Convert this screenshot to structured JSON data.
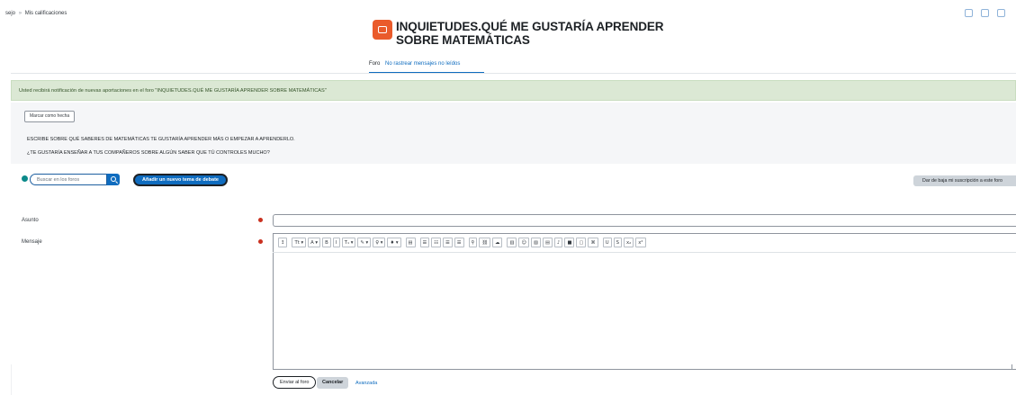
{
  "breadcrumb": {
    "left": "sejo",
    "sep": "»",
    "current": "Mis calificaciones"
  },
  "forum": {
    "title": "INQUIETUDES.QUÉ ME GUSTARÍA APRENDER SOBRE MATEMÁTICAS",
    "tabs": [
      "Foro",
      "No rastrear mensajes no leídos"
    ],
    "icon": "forum-icon"
  },
  "alert": {
    "text": "Usted recibirá notificación de nuevas aportaciones en el foro \"INQUIETUDES.QUÉ ME GUSTARÍA APRENDER SOBRE MATEMÁTICAS\""
  },
  "completion": {
    "mark_done_label": "Marcar como hecha"
  },
  "instructions": [
    "ESCRIBE SOBRE QUÉ SABERES DE MATEMÁTICAS TE GUSTARÍA APRENDER MÁS O EMPEZAR A APRENDERLO.",
    "¿TE GUSTARÍA ENSEÑAR A TUS COMPAÑEROS SOBRE ALGÚN SABER QUE TÚ CONTROLES MUCHO?"
  ],
  "search": {
    "placeholder": "Buscar en los foros"
  },
  "actions": {
    "add_topic": "Añadir un nuevo tema de debate",
    "unsubscribe": "Dar de baja mi suscripción a este foro"
  },
  "form": {
    "subject_label": "Asunto",
    "message_label": "Mensaje",
    "subject_value": "",
    "submit_label": "Enviar al foro",
    "cancel_label": "Cancelar",
    "advanced_label": "Avanzada"
  },
  "toolbar_buttons": [
    "↥",
    "Tt ▾",
    "A ▾",
    "B",
    "I",
    "T₁ ▾",
    "✎ ▾",
    "♀ ▾",
    "♦ ▾",
    "▤",
    "☰",
    "☷",
    "☰",
    "☰",
    "⚲",
    "⛓",
    "☁",
    "▥",
    "☺",
    "▨",
    "▤",
    "♪",
    "■",
    "▢",
    "⌘",
    "U",
    "S",
    "x₂",
    "x²"
  ],
  "colors": {
    "accent": "#0f6cbf",
    "alert_bg": "#dbe8d4",
    "forum_icon": "#ea5b2b",
    "required": "#ca3120"
  }
}
